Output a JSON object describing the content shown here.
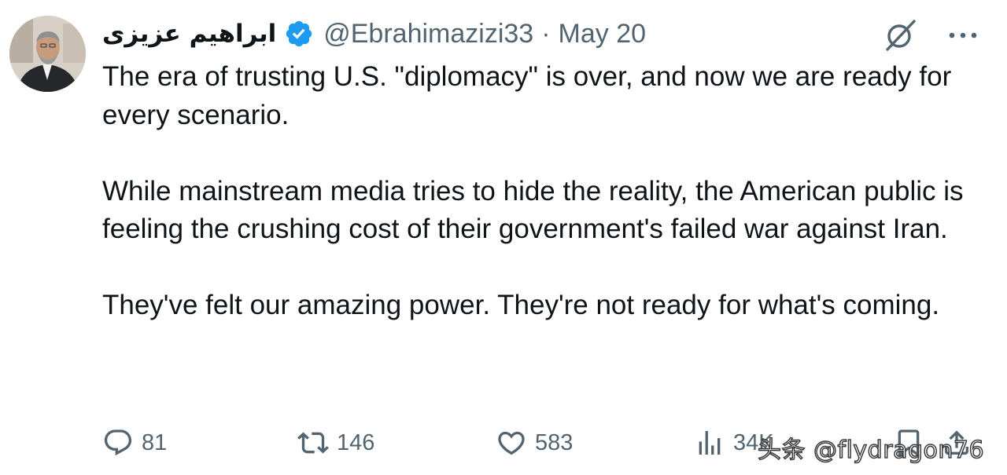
{
  "tweet": {
    "author_name": "ابراهیم عزیزی",
    "handle": "@Ebrahimazizi33",
    "separator": "·",
    "date": "May 20",
    "paragraphs": [
      "The era of trusting U.S. \"diplomacy\" is over, and now we are ready for every scenario.",
      "While mainstream media tries to hide the reality, the American public is feeling the crushing cost of their government's failed war against Iran.",
      "They've felt our amazing power. They're not ready for what's coming."
    ],
    "replies": "81",
    "reposts": "146",
    "likes": "583",
    "views": "34K"
  },
  "icons": {
    "verified": "verified-badge-icon",
    "grok": "grok-icon",
    "more": "more-icon",
    "reply": "reply-icon",
    "repost": "repost-icon",
    "like": "like-icon",
    "views": "views-icon",
    "bookmark": "bookmark-icon",
    "share": "share-icon"
  },
  "colors": {
    "verified_blue": "#1d9bf0",
    "secondary_text": "#536471",
    "primary_text": "#0f1419"
  },
  "watermark": "头条 @flydragon76"
}
